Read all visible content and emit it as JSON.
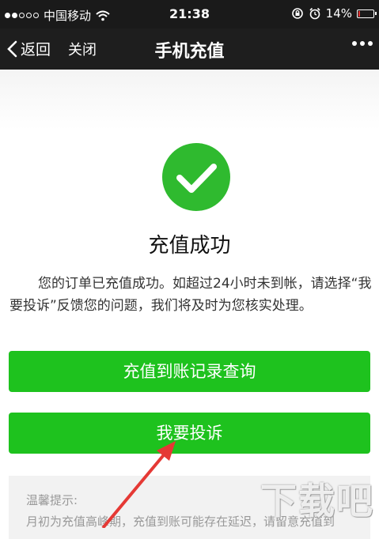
{
  "status_bar": {
    "carrier": "中国移动",
    "time": "21:38",
    "battery_percent": "14%",
    "signal_bars_filled": 2,
    "signal_bars_total": 5,
    "battery_level": 0.14,
    "battery_color": "#e33333"
  },
  "nav": {
    "back_label": "返回",
    "close_label": "关闭",
    "title": "手机充值",
    "more_icon": "more-dots-icon"
  },
  "result": {
    "icon": "check-circle-icon",
    "icon_color": "#2fba2f",
    "title": "充值成功",
    "message": "您的订单已充值成功。如超过24小时未到帐，请选择“我要投诉”反馈您的问题，我们将及时为您核实处理。"
  },
  "buttons": {
    "records_label": "充值到账记录查询",
    "complain_label": "我要投诉",
    "button_color": "#1ec21e"
  },
  "tips": {
    "title": "温馨提示:",
    "line1": "月初为充值高峰期，充值到账可能存在延迟，请留意充值到"
  },
  "annotation": {
    "arrow_color": "#e53935"
  },
  "watermark": {
    "text": "下载吧"
  }
}
